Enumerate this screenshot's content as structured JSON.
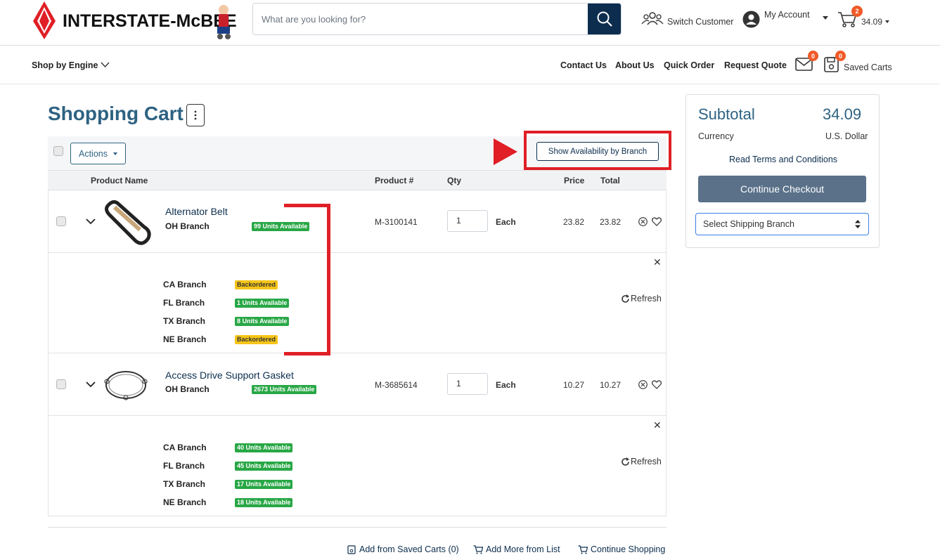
{
  "header": {
    "logo_text": "INTERSTATE-McBEE",
    "search_placeholder": "What are you looking for?",
    "switch_customer": "Switch Customer",
    "my_account": "My Account",
    "cart_count": "2",
    "cart_total": "34.09"
  },
  "nav": {
    "shop_by_engine": "Shop by Engine",
    "links": [
      "Contact Us",
      "About Us",
      "Quick Order",
      "Request Quote"
    ],
    "messages_count": "0",
    "saved_carts_count": "0",
    "saved_carts": "Saved Carts"
  },
  "page": {
    "title": "Shopping Cart",
    "actions_label": "Actions",
    "availability_btn": "Show Availability by Branch"
  },
  "table": {
    "headers": [
      "Product Name",
      "Product #",
      "Qty",
      "Price",
      "Total"
    ]
  },
  "items": [
    {
      "name": "Alternator Belt",
      "branch": "OH Branch",
      "branch_status": "99 Units Available",
      "product_no": "M-3100141",
      "qty": "1",
      "unit": "Each",
      "price": "23.82",
      "total": "23.82",
      "branches": [
        {
          "name": "CA Branch",
          "status": "Backordered",
          "type": "yellow"
        },
        {
          "name": "FL Branch",
          "status": "1 Units Available",
          "type": "green"
        },
        {
          "name": "TX Branch",
          "status": "8 Units Available",
          "type": "green"
        },
        {
          "name": "NE Branch",
          "status": "Backordered",
          "type": "yellow"
        }
      ],
      "refresh": "Refresh"
    },
    {
      "name": "Access Drive Support Gasket",
      "branch": "OH Branch",
      "branch_status": "2673 Units Available",
      "product_no": "M-3685614",
      "qty": "1",
      "unit": "Each",
      "price": "10.27",
      "total": "10.27",
      "branches": [
        {
          "name": "CA Branch",
          "status": "40 Units Available",
          "type": "green"
        },
        {
          "name": "FL Branch",
          "status": "45 Units Available",
          "type": "green"
        },
        {
          "name": "TX Branch",
          "status": "17 Units Available",
          "type": "green"
        },
        {
          "name": "NE Branch",
          "status": "18 Units Available",
          "type": "green"
        }
      ],
      "refresh": "Refresh"
    }
  ],
  "footer": {
    "add_saved": "Add from Saved Carts (0)",
    "add_list": "Add More from List",
    "continue": "Continue Shopping"
  },
  "summary": {
    "subtotal_label": "Subtotal",
    "subtotal_value": "34.09",
    "currency_label": "Currency",
    "currency_value": "U.S. Dollar",
    "terms": "Read Terms and Conditions",
    "checkout": "Continue Checkout",
    "shipping_select": "Select Shipping Branch"
  },
  "colors": {
    "brand_red": "#e01f26",
    "navy": "#0c2d4e",
    "title_blue": "#2e6282",
    "green": "#28a745",
    "yellow": "#f5c518"
  }
}
